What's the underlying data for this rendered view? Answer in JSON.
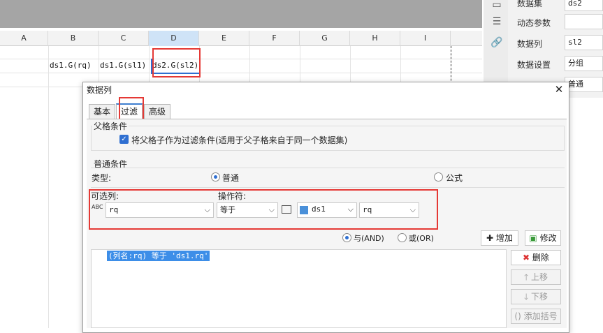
{
  "sheet": {
    "columns": [
      "A",
      "B",
      "C",
      "D",
      "E",
      "F",
      "G",
      "H",
      "I"
    ],
    "cells": {
      "b2": "ds1.G(rq)",
      "c2": "ds1.G(sl1)",
      "d2": "ds2.G(sl2)"
    }
  },
  "props": {
    "dataset_label": "数据集",
    "dataset_value": "ds2",
    "dynamic_label": "动态参数",
    "column_label": "数据列",
    "column_value": "sl2",
    "setting_label": "数据设置",
    "setting_value": "分组",
    "extra_value": "普通"
  },
  "dialog": {
    "title": "数据列",
    "tabs": [
      "基本",
      "过滤",
      "高级"
    ],
    "active_tab": "过滤",
    "parent_group_title": "父格条件",
    "parent_checkbox_label": "将父格子作为过滤条件(适用于父子格来自于同一个数据集)",
    "normal_group_title": "普通条件",
    "type_label": "类型:",
    "type_normal": "普通",
    "type_formula": "公式",
    "optional_col_label": "可选列:",
    "operator_label": "操作符:",
    "optional_col_value": "rq",
    "operator_value": "等于",
    "ds_value": "ds1",
    "ds_col_value": "rq",
    "and_label": "与(AND)",
    "or_label": "或(OR)",
    "add_button": "增加",
    "modify_button": "修改",
    "delete_button": "删除",
    "up_button": "上移",
    "down_button": "下移",
    "bracket_button": "添加括号",
    "condition_item": "(列名:rq) 等于 'ds1.rq'"
  },
  "colors": {
    "accent": "#2f6fd1",
    "highlight_box": "#e53935",
    "selection": "#3d8ee8"
  }
}
